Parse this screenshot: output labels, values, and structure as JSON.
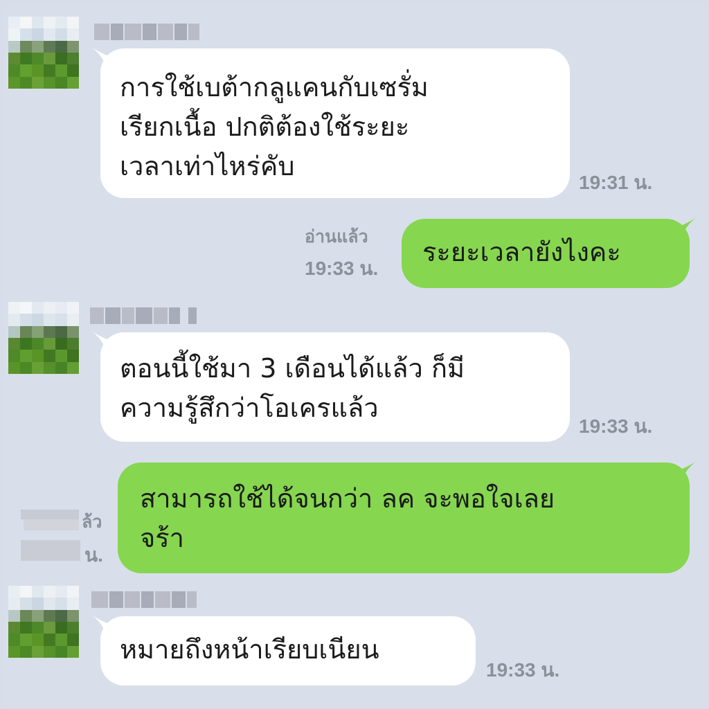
{
  "chat": {
    "messages": [
      {
        "side": "in",
        "text": "การใช้เบต้ากลูแคนกับเซรั่ม\nเรียกเนื้อ ปกติต้องใช้ระยะ\nเวลาเท่าไหร่คับ",
        "time": "19:31 น."
      },
      {
        "side": "out",
        "text": "ระยะเวลายังไงคะ",
        "read": "อ่านแล้ว",
        "time": "19:33 น."
      },
      {
        "side": "in",
        "text": "ตอนนี้ใช้มา 3 เดือนได้แล้ว ก็มี\nความรู้สึกว่าโอเครแล้ว",
        "time": "19:33 น."
      },
      {
        "side": "out",
        "text": "สามารถใช้ได้จนกว่า ลค จะพอใจเลย\nจร้า",
        "read_partial": "ล้ว",
        "time_partial": "น."
      },
      {
        "side": "in",
        "text": "หมายถึงหน้าเรียบเนียน",
        "time": "19:33 น."
      }
    ]
  },
  "colors": {
    "background": "#d8dfea",
    "incoming": "#ffffff",
    "outgoing": "#86d650",
    "meta": "#8b9099"
  },
  "icons": {
    "avatar": "avatar-pixelated",
    "name": "name-blurred"
  }
}
